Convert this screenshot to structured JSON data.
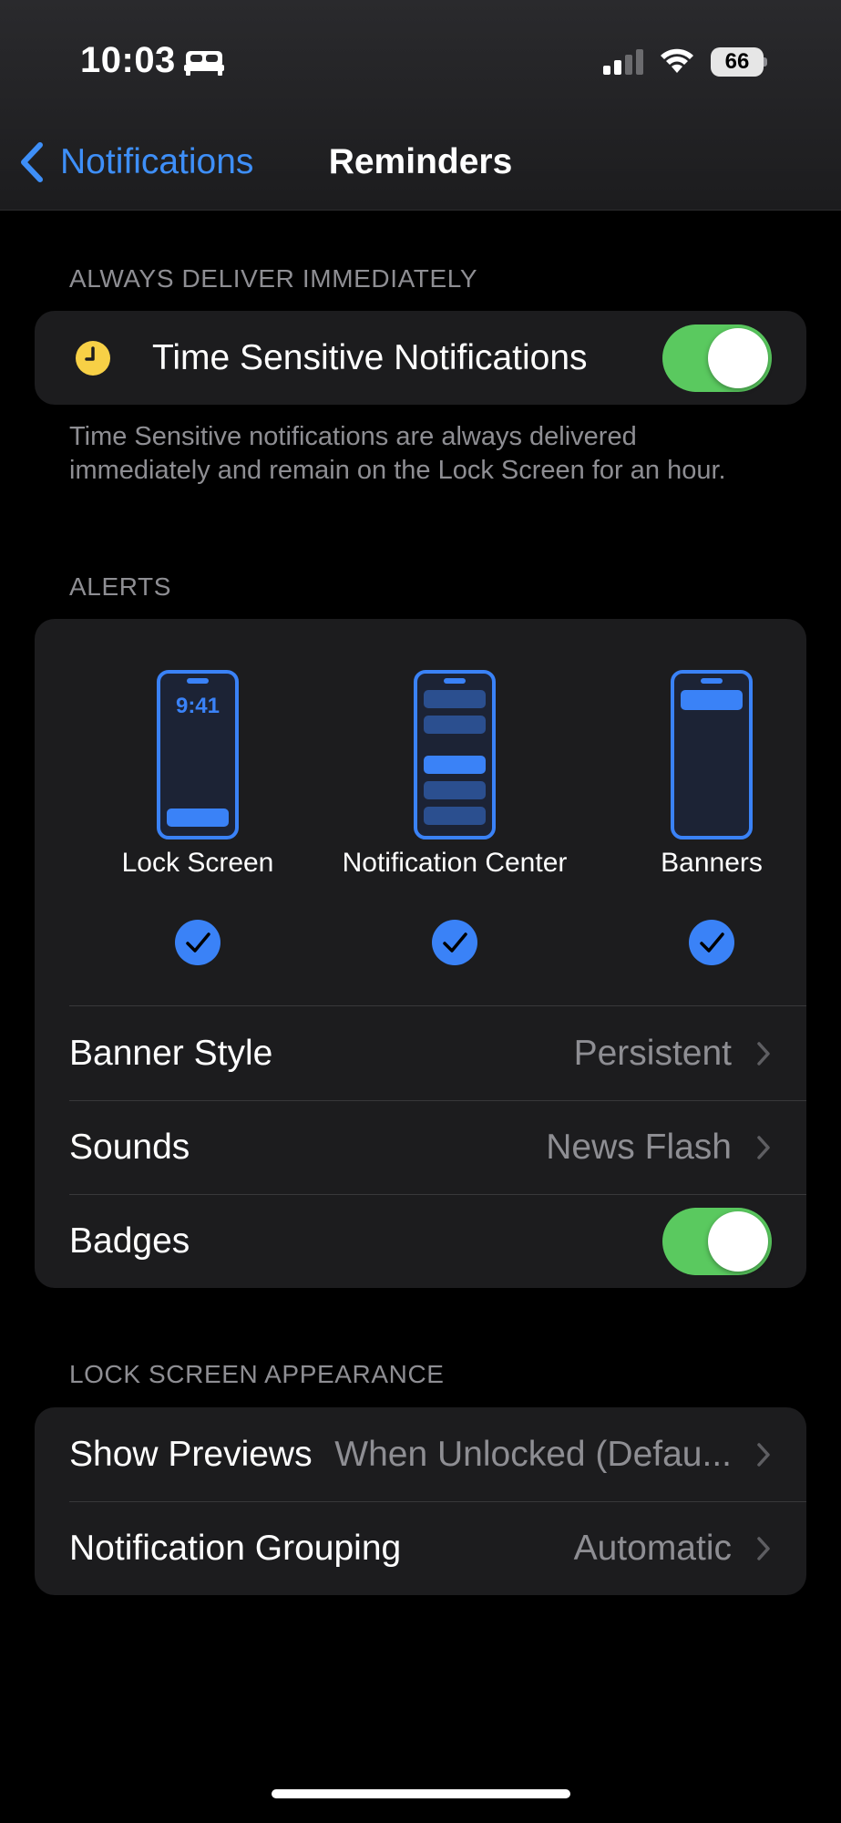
{
  "status_bar": {
    "time": "10:03",
    "battery": "66",
    "icons": [
      "bed-icon",
      "cellular-signal-icon",
      "wifi-icon",
      "battery-icon"
    ]
  },
  "nav": {
    "back_label": "Notifications",
    "title": "Reminders",
    "back_icon": "chevron-left-icon"
  },
  "always_deliver": {
    "header": "ALWAYS DELIVER IMMEDIATELY",
    "row_label": "Time Sensitive Notifications",
    "row_icon": "clock-icon",
    "toggle_on": true,
    "footer": "Time Sensitive notifications are always delivered immediately and remain on the Lock Screen for an hour."
  },
  "alerts": {
    "header": "ALERTS",
    "options": [
      {
        "label": "Lock Screen",
        "preview_time": "9:41",
        "checked": true
      },
      {
        "label": "Notification Center",
        "checked": true
      },
      {
        "label": "Banners",
        "checked": true
      }
    ],
    "rows": {
      "banner_style": {
        "label": "Banner Style",
        "value": "Persistent"
      },
      "sounds": {
        "label": "Sounds",
        "value": "News Flash"
      },
      "badges": {
        "label": "Badges",
        "toggle_on": true
      }
    }
  },
  "lock_screen_appearance": {
    "header": "LOCK SCREEN APPEARANCE",
    "rows": {
      "show_previews": {
        "label": "Show Previews",
        "value": "When Unlocked (Defau..."
      },
      "notification_grouping": {
        "label": "Notification Grouping",
        "value": "Automatic"
      }
    }
  },
  "colors": {
    "accent": "#3e8ff8",
    "toggle_on": "#5ac95f",
    "card_bg": "#1c1c1e",
    "secondary_text": "#8e8e93",
    "clock_yellow": "#f7d046"
  }
}
